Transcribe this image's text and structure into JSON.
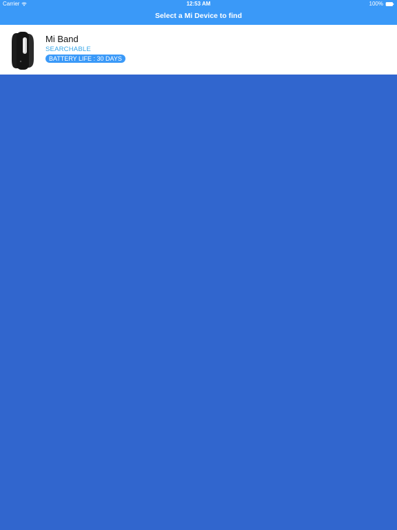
{
  "status_bar": {
    "carrier": "Carrier",
    "time": "12:53 AM",
    "battery_percent": "100%"
  },
  "nav": {
    "title": "Select a Mi Device to find"
  },
  "devices": [
    {
      "name": "Mi Band",
      "status": "SEARCHABLE",
      "battery_life_label": "BATTERY LIFE :  30 DAYS",
      "icon": "fitness-band-icon"
    }
  ],
  "colors": {
    "nav_background": "#3A99F8",
    "screen_background": "#3166CE",
    "row_background": "#FFFFFF",
    "status_text": "#35A5E8",
    "pill_background": "#3A99F8"
  }
}
